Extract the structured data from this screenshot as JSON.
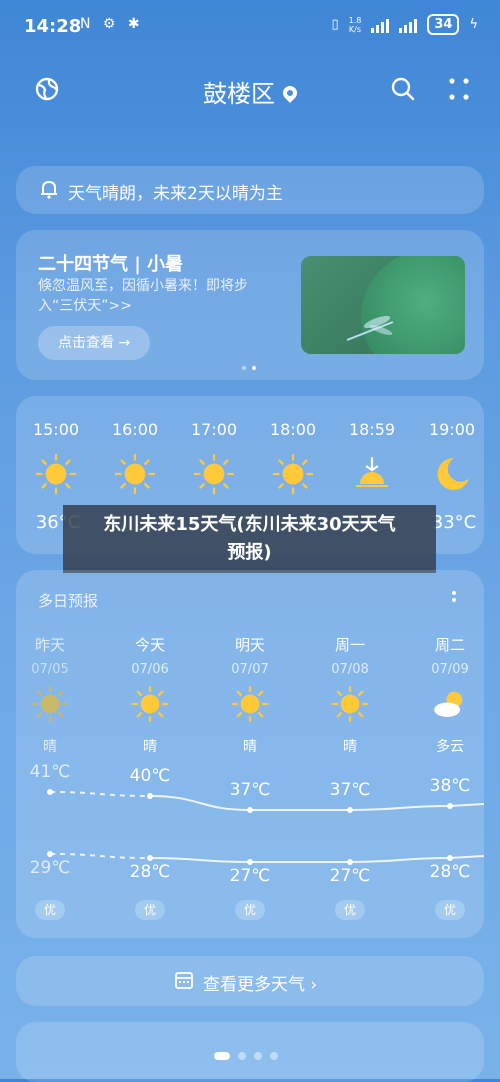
{
  "status_bar": {
    "time": "14:28",
    "left_icons": "N ⚙ ✱",
    "net_speed_top": "1.8",
    "net_speed_bottom": "K/s",
    "battery": "34"
  },
  "header": {
    "city": "鼓楼区"
  },
  "alert": {
    "text": "天气晴朗，未来2天以晴为主"
  },
  "solar_term": {
    "title": "二十四节气 | 小暑",
    "desc": "倏忽温风至，因循小暑来！即将步入“三伏天”>>",
    "button": "点击查看 →"
  },
  "hourly": [
    {
      "time": "15:00",
      "icon": "sun-icon",
      "temp": "36°C"
    },
    {
      "time": "16:00",
      "icon": "sun-icon",
      "temp": ""
    },
    {
      "time": "17:00",
      "icon": "sun-icon",
      "temp": ""
    },
    {
      "time": "18:00",
      "icon": "sun-icon",
      "temp": ""
    },
    {
      "time": "18:59",
      "icon": "sunset-icon",
      "temp": ""
    },
    {
      "time": "19:00",
      "icon": "moon-icon",
      "temp": "33°C"
    }
  ],
  "overlay": {
    "line1": "东川未来15天气(东川未来30天天气",
    "line2": "预报)"
  },
  "daily": {
    "title": "多日预报",
    "days": [
      {
        "name": "昨天",
        "date": "07/05",
        "cond": "晴",
        "high": "41℃",
        "low": "29℃",
        "aqi": "优",
        "icon": "sun-icon"
      },
      {
        "name": "今天",
        "date": "07/06",
        "cond": "晴",
        "high": "40℃",
        "low": "28℃",
        "aqi": "优",
        "icon": "sun-icon"
      },
      {
        "name": "明天",
        "date": "07/07",
        "cond": "晴",
        "high": "37℃",
        "low": "27℃",
        "aqi": "优",
        "icon": "sun-icon"
      },
      {
        "name": "周一",
        "date": "07/08",
        "cond": "晴",
        "high": "37℃",
        "low": "27℃",
        "aqi": "优",
        "icon": "sun-icon"
      },
      {
        "name": "周二",
        "date": "07/09",
        "cond": "多云",
        "high": "38℃",
        "low": "28℃",
        "aqi": "优",
        "icon": "partly-cloudy-icon"
      }
    ]
  },
  "more_weather": {
    "label": "查看更多天气 ›"
  },
  "colors": {
    "sun": "#ffc93a",
    "sun_muted": "#c8b86a",
    "overlay": "#323c4b"
  }
}
